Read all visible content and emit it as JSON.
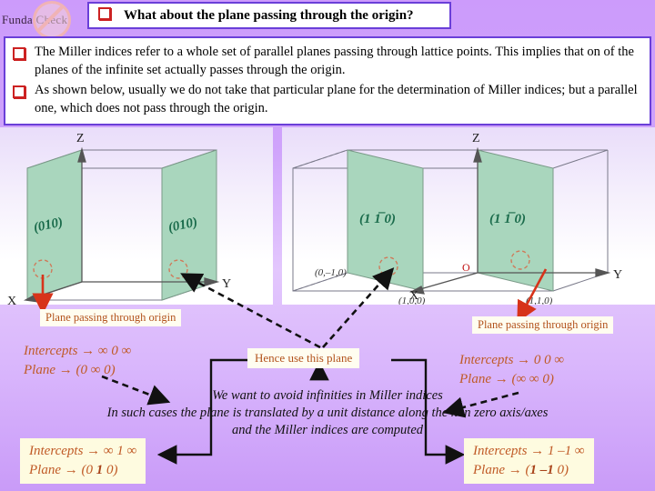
{
  "badge": {
    "text": "Funda Check",
    "icon": "no-entry-icon"
  },
  "header": {
    "bullet_icon": "square-bullet-icon",
    "question": "What about the plane passing through the origin?"
  },
  "bullets": [
    "The Miller indices refer to a whole set of parallel planes passing through lattice points. This implies that on of the planes of the infinite set actually passes through the origin.",
    "As shown below, usually we do not take that particular plane for the determination of Miller indices; but a parallel one, which does not pass through the origin."
  ],
  "diagram_left": {
    "axes": {
      "z": "Z",
      "x": "X",
      "y": "Y"
    },
    "plane_labels": [
      "(010)",
      "(010)"
    ],
    "origin_marker": "dashed-circle-icon"
  },
  "diagram_right": {
    "axes": {
      "z": "Z",
      "x": "X",
      "y": "Y"
    },
    "plane_labels": [
      "(1 1̅ 0)",
      "(1 1̅ 0)"
    ],
    "point_labels": [
      "(0,–1,0)",
      "(1,0,0)",
      "(1,1,0)"
    ],
    "origin_label": "O",
    "origin_marker": "dashed-circle-icon"
  },
  "callouts": {
    "origin_left": "Plane passing through origin",
    "origin_right": "Plane passing through origin",
    "hence": "Hence use this plane"
  },
  "intercepts_left": {
    "line1": "Intercepts → ∞ 0 ∞",
    "line2": "Plane → (0 ∞ 0)"
  },
  "intercepts_right": {
    "line1": "Intercepts → 0 0 ∞",
    "line2": "Plane → (∞ ∞ 0)"
  },
  "center_note": [
    "We want to avoid infinities in Miller indices",
    "In such cases the plane is translated by a unit distance along the non zero axis/axes",
    "and the Miller indices are computed"
  ],
  "result_left": {
    "line1": "Intercepts → ∞ 1 ∞",
    "line2_pre": "Plane → (0 ",
    "line2_bold": "1",
    "line2_post": " 0)"
  },
  "result_right": {
    "line1": "Intercepts → 1 –1 ∞",
    "line2_pre": "Plane → (",
    "line2_bold": "1 –1",
    "line2_post": " 0)"
  },
  "colors": {
    "background": "#cc9bfb",
    "box_border": "#6a3fd8",
    "plane_fill": "#a9d6bd",
    "accent_red": "#d7331a",
    "callout_text": "#b2521c",
    "label_green": "#1a6b4b"
  }
}
